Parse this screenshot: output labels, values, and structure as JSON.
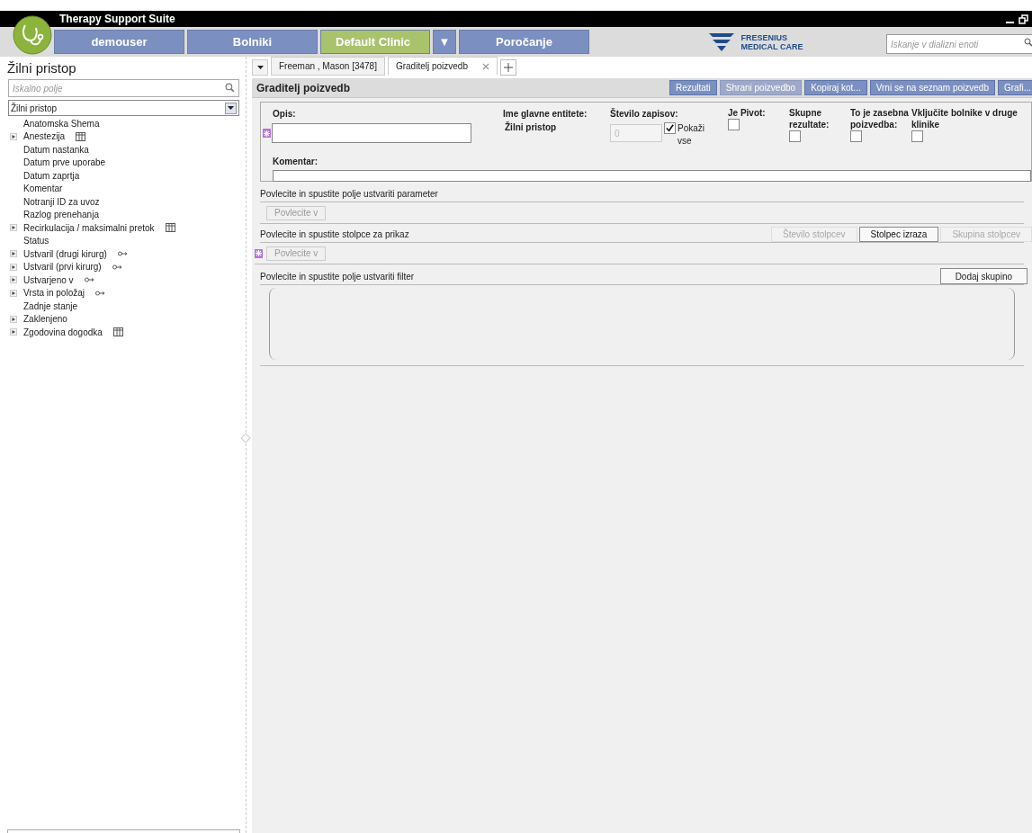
{
  "window": {
    "title": "Therapy Support Suite"
  },
  "nav": [
    {
      "label": "demouser",
      "kind": "user"
    },
    {
      "label": "Bolniki",
      "kind": "menu"
    },
    {
      "label": "Default Clinic",
      "kind": "clinic"
    },
    {
      "label": "▼",
      "kind": "dropdown"
    },
    {
      "label": "Poročanje",
      "kind": "menu"
    }
  ],
  "logo": {
    "line1": "FRESENIUS",
    "line2": "MEDICAL CARE"
  },
  "unit_search": {
    "placeholder": "Iskanje v dializni enoti"
  },
  "sidebar": {
    "title": "Žilni pristop",
    "search": {
      "placeholder": "Iskalno polje"
    },
    "entity": {
      "value": "Žilni pristop"
    },
    "items": [
      {
        "label": "Anatomska Shema",
        "expandable": false,
        "kind": "field"
      },
      {
        "label": "Anestezija",
        "expandable": true,
        "kind": "table"
      },
      {
        "label": "Datum nastanka",
        "expandable": false,
        "kind": "field"
      },
      {
        "label": "Datum prve uporabe",
        "expandable": false,
        "kind": "field"
      },
      {
        "label": "Datum zaprtja",
        "expandable": false,
        "kind": "field"
      },
      {
        "label": "Komentar",
        "expandable": false,
        "kind": "field"
      },
      {
        "label": "Notranji ID za uvoz",
        "expandable": false,
        "kind": "field"
      },
      {
        "label": "Razlog prenehanja",
        "expandable": false,
        "kind": "field"
      },
      {
        "label": "Recirkulacija / maksimalni pretok",
        "expandable": true,
        "kind": "table"
      },
      {
        "label": "Status",
        "expandable": false,
        "kind": "field"
      },
      {
        "label": "Ustvaril (drugi kirurg)",
        "expandable": true,
        "kind": "link"
      },
      {
        "label": "Ustvaril (prvi kirurg)",
        "expandable": true,
        "kind": "link"
      },
      {
        "label": "Ustvarjeno v",
        "expandable": true,
        "kind": "link"
      },
      {
        "label": "Vrsta in položaj",
        "expandable": true,
        "kind": "link"
      },
      {
        "label": "Zadnje stanje",
        "expandable": false,
        "kind": "field"
      },
      {
        "label": "Zaklenjeno",
        "expandable": true,
        "kind": "field"
      },
      {
        "label": "Zgodovina dogodka",
        "expandable": true,
        "kind": "table"
      }
    ]
  },
  "tabs": [
    {
      "label": "Freeman , Mason [3478]",
      "selected": false,
      "closable": false
    },
    {
      "label": "Graditelj poizvedb",
      "selected": true,
      "closable": true
    }
  ],
  "panel": {
    "title": "Graditelj poizvedb",
    "toolbar": [
      {
        "label": "Rezultati",
        "disabled": false
      },
      {
        "label": "Shrani poizvedbo",
        "disabled": true
      },
      {
        "label": "Kopiraj kot...",
        "disabled": false
      },
      {
        "label": "Vrni se na seznam poizvedb",
        "disabled": false
      },
      {
        "label": "Grafi...",
        "disabled": false
      }
    ],
    "description_label": "Opis:",
    "entity_label": "Ime glavne entitete:",
    "entity_value": "Žilni pristop",
    "records_label": "Število zapisov:",
    "records_value": "0",
    "show_all": {
      "label": "Pokaži vse",
      "checked": true
    },
    "flags": [
      {
        "label": "Je Pivot:",
        "checked": false
      },
      {
        "label": "Skupne rezultate:",
        "checked": false
      },
      {
        "label": "To je zasebna poizvedba:",
        "checked": false
      },
      {
        "label": "Vključite bolnike v druge klinike",
        "checked": false
      }
    ],
    "comment_label": "Komentar:",
    "param_section": {
      "title": "Povlecite in spustite polje ustvariti parameter",
      "drop": "Povlecite v"
    },
    "column_section": {
      "title": "Povlecite in spustite stolpce za prikaz",
      "drop": "Povlecite v",
      "buttons": [
        {
          "label": "Število stolpcev",
          "disabled": true
        },
        {
          "label": "Stolpec izraza",
          "disabled": false
        },
        {
          "label": "Skupina stolpcev",
          "disabled": true
        }
      ]
    },
    "filter_section": {
      "title": "Povlecite in spustite polje ustvariti filter",
      "button": "Dodaj skupino"
    }
  }
}
